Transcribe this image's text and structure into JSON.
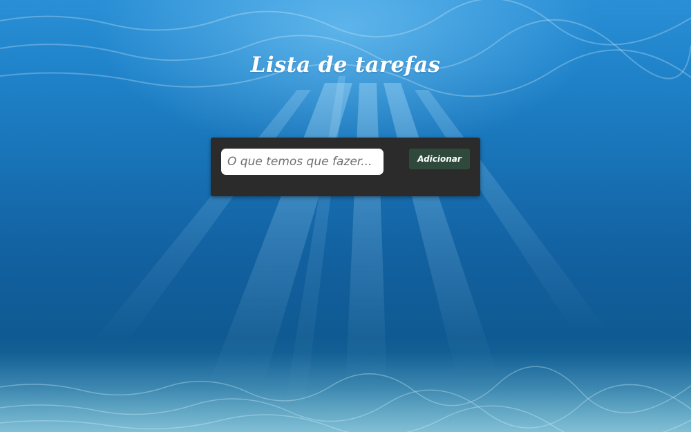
{
  "page": {
    "title": "Lista de tarefas"
  },
  "form": {
    "task_input_placeholder": "O que temos que fazer...",
    "task_input_value": "",
    "add_button_label": "Adicionar"
  },
  "colors": {
    "panel_background": "#2b2b2b",
    "add_button_background": "#2f4a3c",
    "input_background": "#ffffff",
    "title_color": "#ffffff"
  },
  "background": {
    "theme": "underwater-ocean-scene"
  }
}
